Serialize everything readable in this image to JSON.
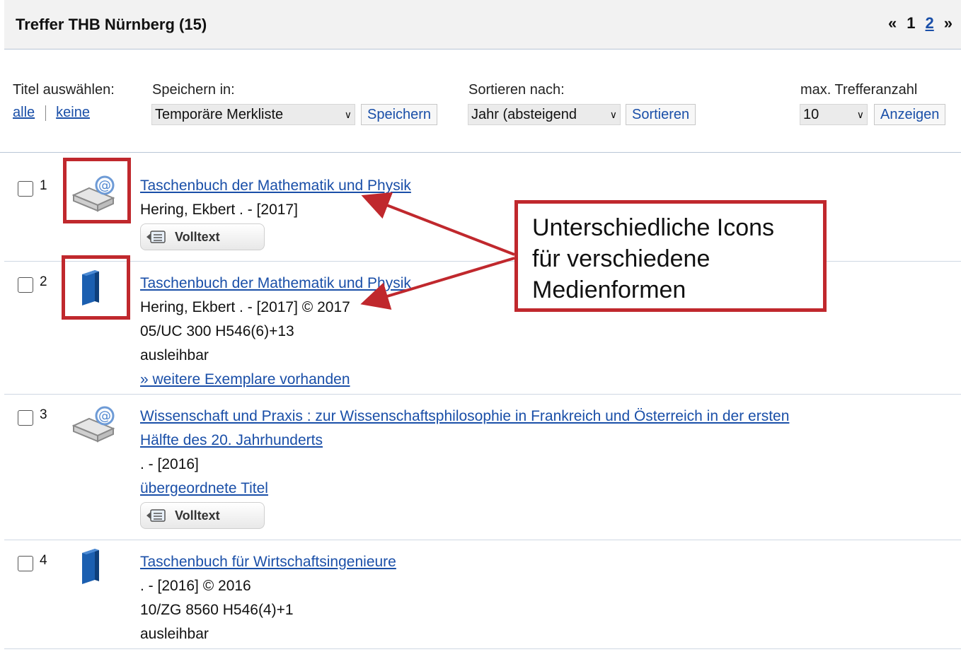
{
  "header": {
    "title": "Treffer THB Nürnberg (15)",
    "pager": {
      "prev": "«",
      "page1": "1",
      "page2": "2",
      "next": "»"
    }
  },
  "controls": {
    "select_title_label": "Titel auswählen:",
    "select_all": "alle",
    "select_none": "keine",
    "save_label": "Speichern in:",
    "save_select_value": "Temporäre Merkliste",
    "save_button": "Speichern",
    "sort_label": "Sortieren nach:",
    "sort_select_value": "Jahr (absteigend",
    "sort_button": "Sortieren",
    "max_label": "max. Trefferanzahl",
    "max_select_value": "10",
    "max_button": "Anzeigen"
  },
  "results": [
    {
      "num": "1",
      "icon": "ebook-icon",
      "title": "Taschenbuch der Mathematik und Physik",
      "line2": "Hering, Ekbert . - [2017]",
      "button": "Volltext"
    },
    {
      "num": "2",
      "icon": "book-icon",
      "title": "Taschenbuch der Mathematik und Physik",
      "line2": "Hering, Ekbert . - [2017] © 2017",
      "line3": "05/UC 300 H546(6)+13",
      "line4": "ausleihbar",
      "link": "» weitere Exemplare vorhanden"
    },
    {
      "num": "3",
      "icon": "ebook-icon",
      "title_line1": "Wissenschaft und Praxis : zur Wissenschaftsphilosophie in Frankreich und Österreich in der ersten",
      "title_line2": "Hälfte des 20. Jahrhunderts",
      "line2": ". - [2016]",
      "link": "übergeordnete Titel",
      "button": "Volltext"
    },
    {
      "num": "4",
      "icon": "book-icon",
      "title": "Taschenbuch für Wirtschaftsingenieure",
      "line2": ". - [2016] © 2016",
      "line3": "10/ZG 8560 H546(4)+1",
      "line4": "ausleihbar"
    }
  ],
  "annotation": {
    "line1": "Unterschiedliche Icons",
    "line2": "für verschiedene",
    "line3": "Medienformen"
  },
  "colors": {
    "link": "#1a4fa8",
    "annotation_red": "#c0282d",
    "book_blue": "#1b5fb0"
  }
}
